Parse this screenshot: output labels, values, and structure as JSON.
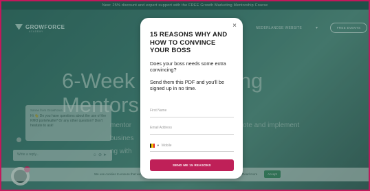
{
  "topbar": {
    "text": "New: 25% discount and expert support with the FREE Growth Marketing Mentorship Course"
  },
  "nav": {
    "logo_text": "GROWFORCE",
    "logo_sub": "ACADEMY",
    "link_nl": "NEDERLANDSE WEBSITE",
    "flag_icon": "belgium-flag-icon",
    "cta": "FREE EVENTS"
  },
  "hero": {
    "title_line1_left": "6-Week G",
    "title_line1_right": "eting",
    "title_line2": "Mentorsh",
    "sub_left_1": "mentor",
    "sub_right_1": "ote and implement",
    "sub_left_2": "busines",
    "sub_left_3": "ng with"
  },
  "chat": {
    "agent_name": "Sanne from GrowForce",
    "message": "Hi 👋 Do you have questions about the use of the KMO portefeuille? Or any other question? Don't hesitate to ask!",
    "input_placeholder": "Write a reply...",
    "icons": [
      "emoji-icon",
      "attachment-icon",
      "send-icon"
    ]
  },
  "cookie": {
    "text": "We use cookies to ensure that we give you the best experience on our website.",
    "text_tail": "Read more",
    "accept_label": "Accept"
  },
  "modal": {
    "title": "15 REASONS WHY AND HOW TO CONVINCE YOUR BOSS",
    "p1": "Does your boss needs some extra convincing?",
    "p2": "Send them this PDF and you'll be signed up in no time.",
    "first_name_placeholder": "First Name",
    "email_placeholder": "Email Address",
    "mobile_placeholder": "Mobile",
    "submit_label": "SEND ME 15 REASONS",
    "close_glyph": "×"
  },
  "colors": {
    "accent": "#bf2058",
    "hero_bg": "#3d7b70",
    "flag_black": "#1a1a1a",
    "flag_yellow": "#f4c800",
    "flag_red": "#e0262b"
  }
}
